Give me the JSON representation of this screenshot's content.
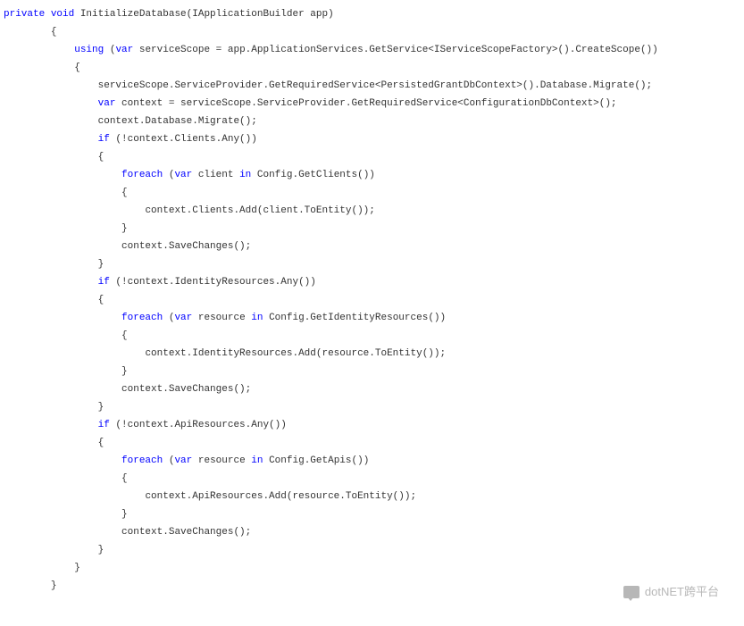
{
  "code": {
    "lines": [
      {
        "indent": 0,
        "segments": [
          {
            "t": "private",
            "c": "kw"
          },
          {
            "t": " ",
            "c": "default"
          },
          {
            "t": "void",
            "c": "kw"
          },
          {
            "t": " InitializeDatabase(IApplicationBuilder app)",
            "c": "default"
          }
        ]
      },
      {
        "indent": 8,
        "segments": [
          {
            "t": "{",
            "c": "default"
          }
        ]
      },
      {
        "indent": 12,
        "segments": [
          {
            "t": "using",
            "c": "kw"
          },
          {
            "t": " (",
            "c": "default"
          },
          {
            "t": "var",
            "c": "kw"
          },
          {
            "t": " serviceScope = app.ApplicationServices.GetService<IServiceScopeFactory>().CreateScope())",
            "c": "default"
          }
        ]
      },
      {
        "indent": 12,
        "segments": [
          {
            "t": "{",
            "c": "default"
          }
        ]
      },
      {
        "indent": 16,
        "segments": [
          {
            "t": "serviceScope.ServiceProvider.GetRequiredService<PersistedGrantDbContext>().Database.Migrate();",
            "c": "default"
          }
        ]
      },
      {
        "indent": 16,
        "segments": [
          {
            "t": "var",
            "c": "kw"
          },
          {
            "t": " context = serviceScope.ServiceProvider.GetRequiredService<ConfigurationDbContext>();",
            "c": "default"
          }
        ]
      },
      {
        "indent": 16,
        "segments": [
          {
            "t": "context.Database.Migrate();",
            "c": "default"
          }
        ]
      },
      {
        "indent": 16,
        "segments": [
          {
            "t": "if",
            "c": "kw"
          },
          {
            "t": " (!context.Clients.Any())",
            "c": "default"
          }
        ]
      },
      {
        "indent": 16,
        "segments": [
          {
            "t": "{",
            "c": "default"
          }
        ]
      },
      {
        "indent": 20,
        "segments": [
          {
            "t": "foreach",
            "c": "kw"
          },
          {
            "t": " (",
            "c": "default"
          },
          {
            "t": "var",
            "c": "kw"
          },
          {
            "t": " client ",
            "c": "default"
          },
          {
            "t": "in",
            "c": "kw"
          },
          {
            "t": " Config.GetClients())",
            "c": "default"
          }
        ]
      },
      {
        "indent": 20,
        "segments": [
          {
            "t": "{",
            "c": "default"
          }
        ]
      },
      {
        "indent": 24,
        "segments": [
          {
            "t": "context.Clients.Add(client.ToEntity());",
            "c": "default"
          }
        ]
      },
      {
        "indent": 20,
        "segments": [
          {
            "t": "}",
            "c": "default"
          }
        ]
      },
      {
        "indent": 20,
        "segments": [
          {
            "t": "context.SaveChanges();",
            "c": "default"
          }
        ]
      },
      {
        "indent": 16,
        "segments": [
          {
            "t": "}",
            "c": "default"
          }
        ]
      },
      {
        "indent": 16,
        "segments": [
          {
            "t": "if",
            "c": "kw"
          },
          {
            "t": " (!context.IdentityResources.Any())",
            "c": "default"
          }
        ]
      },
      {
        "indent": 16,
        "segments": [
          {
            "t": "{",
            "c": "default"
          }
        ]
      },
      {
        "indent": 20,
        "segments": [
          {
            "t": "foreach",
            "c": "kw"
          },
          {
            "t": " (",
            "c": "default"
          },
          {
            "t": "var",
            "c": "kw"
          },
          {
            "t": " resource ",
            "c": "default"
          },
          {
            "t": "in",
            "c": "kw"
          },
          {
            "t": " Config.GetIdentityResources())",
            "c": "default"
          }
        ]
      },
      {
        "indent": 20,
        "segments": [
          {
            "t": "{",
            "c": "default"
          }
        ]
      },
      {
        "indent": 24,
        "segments": [
          {
            "t": "context.IdentityResources.Add(resource.ToEntity());",
            "c": "default"
          }
        ]
      },
      {
        "indent": 20,
        "segments": [
          {
            "t": "}",
            "c": "default"
          }
        ]
      },
      {
        "indent": 20,
        "segments": [
          {
            "t": "context.SaveChanges();",
            "c": "default"
          }
        ]
      },
      {
        "indent": 16,
        "segments": [
          {
            "t": "}",
            "c": "default"
          }
        ]
      },
      {
        "indent": 16,
        "segments": [
          {
            "t": "if",
            "c": "kw"
          },
          {
            "t": " (!context.ApiResources.Any())",
            "c": "default"
          }
        ]
      },
      {
        "indent": 16,
        "segments": [
          {
            "t": "{",
            "c": "default"
          }
        ]
      },
      {
        "indent": 20,
        "segments": [
          {
            "t": "foreach",
            "c": "kw"
          },
          {
            "t": " (",
            "c": "default"
          },
          {
            "t": "var",
            "c": "kw"
          },
          {
            "t": " resource ",
            "c": "default"
          },
          {
            "t": "in",
            "c": "kw"
          },
          {
            "t": " Config.GetApis())",
            "c": "default"
          }
        ]
      },
      {
        "indent": 20,
        "segments": [
          {
            "t": "{",
            "c": "default"
          }
        ]
      },
      {
        "indent": 24,
        "segments": [
          {
            "t": "context.ApiResources.Add(resource.ToEntity());",
            "c": "default"
          }
        ]
      },
      {
        "indent": 20,
        "segments": [
          {
            "t": "}",
            "c": "default"
          }
        ]
      },
      {
        "indent": 20,
        "segments": [
          {
            "t": "context.SaveChanges();",
            "c": "default"
          }
        ]
      },
      {
        "indent": 16,
        "segments": [
          {
            "t": "}",
            "c": "default"
          }
        ]
      },
      {
        "indent": 12,
        "segments": [
          {
            "t": "}",
            "c": "default"
          }
        ]
      },
      {
        "indent": 8,
        "segments": [
          {
            "t": "}",
            "c": "default"
          }
        ]
      }
    ]
  },
  "watermark": {
    "text": "dotNET跨平台"
  }
}
